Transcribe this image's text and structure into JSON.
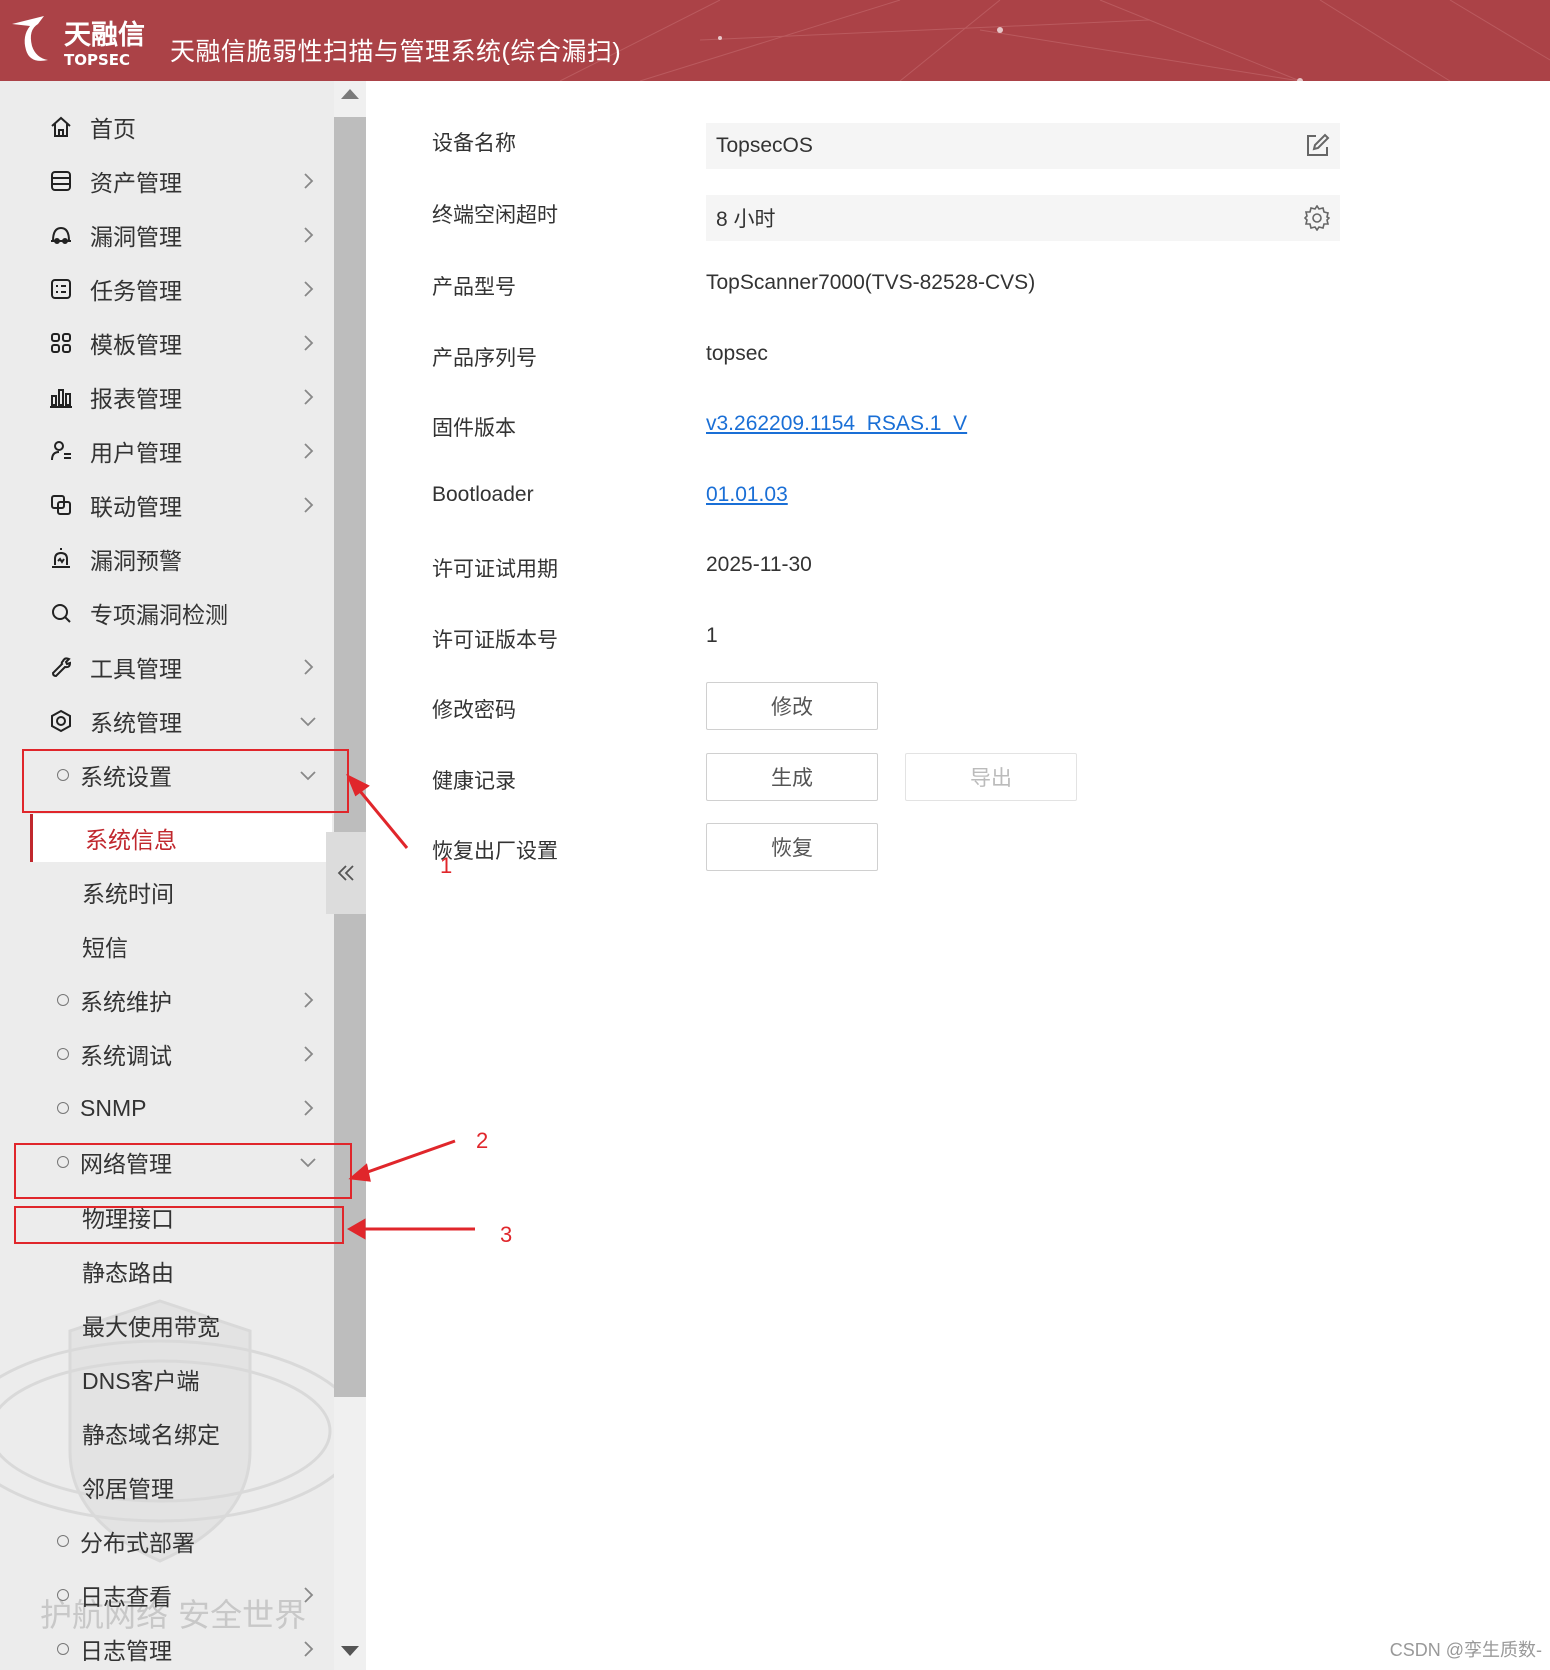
{
  "header": {
    "logo_cn": "天融信",
    "logo_en": "TOPSEC",
    "app_title": "天融信脆弱性扫描与管理系统(综合漏扫)"
  },
  "sidebar": {
    "menu": [
      {
        "label": "首页",
        "icon": "home-icon"
      },
      {
        "label": "资产管理",
        "icon": "asset-icon"
      },
      {
        "label": "漏洞管理",
        "icon": "vuln-icon"
      },
      {
        "label": "任务管理",
        "icon": "task-icon"
      },
      {
        "label": "模板管理",
        "icon": "template-icon"
      },
      {
        "label": "报表管理",
        "icon": "report-icon"
      },
      {
        "label": "用户管理",
        "icon": "user-icon"
      },
      {
        "label": "联动管理",
        "icon": "link-icon"
      },
      {
        "label": "漏洞预警",
        "icon": "alarm-icon"
      },
      {
        "label": "专项漏洞检测",
        "icon": "search-icon"
      },
      {
        "label": "工具管理",
        "icon": "tool-icon"
      },
      {
        "label": "系统管理",
        "icon": "system-icon"
      }
    ],
    "sub_system_settings": "系统设置",
    "leaf_system_info": "系统信息",
    "leaf_system_time": "系统时间",
    "leaf_sms": "短信",
    "sub_maintenance": "系统维护",
    "sub_debug": "系统调试",
    "sub_snmp": "SNMP",
    "sub_network": "网络管理",
    "leaf_physical_if": "物理接口",
    "leaf_static_route": "静态路由",
    "leaf_max_bandwidth": "最大使用带宽",
    "leaf_dns_client": "DNS客户端",
    "leaf_static_domain": "静态域名绑定",
    "leaf_neighbor": "邻居管理",
    "sub_distributed": "分布式部署",
    "sub_log_view": "日志查看",
    "sub_log_manage": "日志管理",
    "watermark_text": "护航网络 安全世界"
  },
  "content": {
    "device_name_label": "设备名称",
    "device_name_value": "TopsecOS",
    "idle_timeout_label": "终端空闲超时",
    "idle_timeout_value": "8 小时",
    "model_label": "产品型号",
    "model_value": "TopScanner7000(TVS-82528-CVS)",
    "serial_label": "产品序列号",
    "serial_value": "topsec",
    "firmware_label": "固件版本",
    "firmware_value": "v3.262209.1154_RSAS.1_V",
    "bootloader_label": "Bootloader",
    "bootloader_value": "01.01.03",
    "license_expiry_label": "许可证试用期",
    "license_expiry_value": "2025-11-30",
    "license_version_label": "许可证版本号",
    "license_version_value": "1",
    "change_password_label": "修改密码",
    "change_password_button": "修改",
    "health_record_label": "健康记录",
    "health_generate_button": "生成",
    "health_export_button": "导出",
    "factory_reset_label": "恢复出厂设置",
    "factory_reset_button": "恢复"
  },
  "annotations": {
    "n1": "1",
    "n2": "2",
    "n3": "3",
    "color": "#e0262b"
  },
  "footer_watermark": "CSDN @孪生质数-",
  "colors": {
    "header": "#ab4247",
    "active": "#c0272d",
    "link": "#1a6fd6"
  }
}
